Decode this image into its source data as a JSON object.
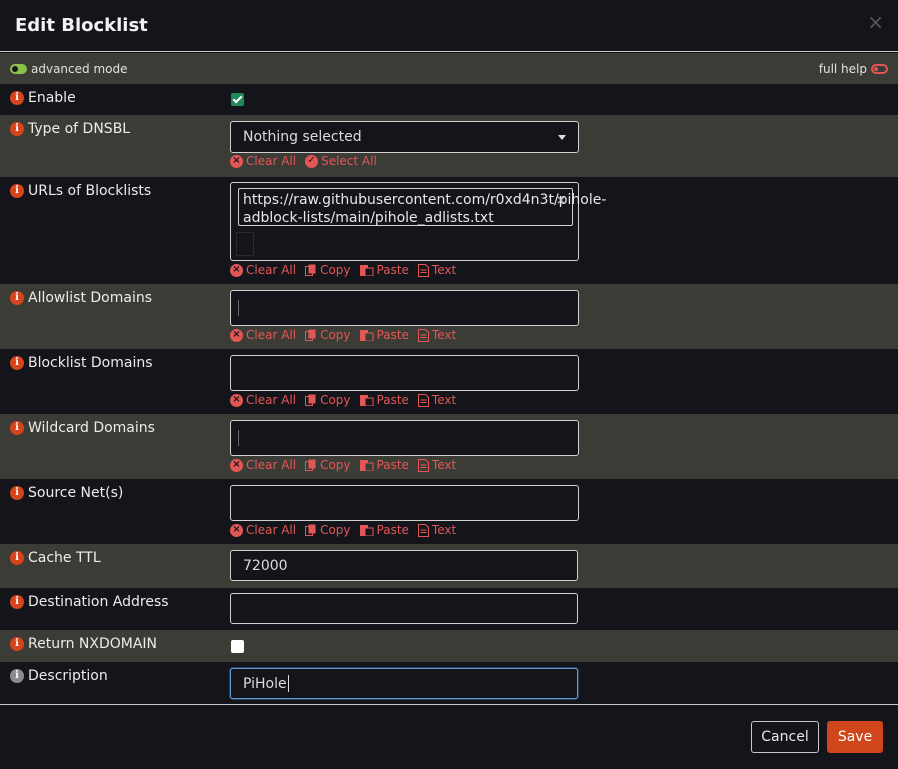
{
  "modal": {
    "title": "Edit Blocklist",
    "close": "×"
  },
  "bar": {
    "advanced": "advanced mode",
    "full_help": "full help"
  },
  "icons": {
    "info": "i"
  },
  "tools": {
    "clear_all": "Clear All",
    "select_all": "Select All",
    "copy": "Copy",
    "paste": "Paste",
    "text": "Text"
  },
  "fields": {
    "enable": {
      "label": "Enable",
      "checked": true
    },
    "type": {
      "label": "Type of DNSBL",
      "value": "Nothing selected"
    },
    "urls": {
      "label": "URLs of Blocklists",
      "tag": "https://raw.githubusercontent.com/r0xd4n3t/pihole-adblock-lists/main/pihole_adlists.txt",
      "tag_close": "×"
    },
    "allowlist": {
      "label": "Allowlist Domains"
    },
    "blocklist": {
      "label": "Blocklist Domains"
    },
    "wildcard": {
      "label": "Wildcard Domains"
    },
    "source": {
      "label": "Source Net(s)"
    },
    "cache": {
      "label": "Cache TTL",
      "value": "72000"
    },
    "dest": {
      "label": "Destination Address",
      "value": ""
    },
    "nxdomain": {
      "label": "Return NXDOMAIN",
      "checked": false
    },
    "description": {
      "label": "Description",
      "value": "PiHole"
    }
  },
  "footer": {
    "cancel": "Cancel",
    "save": "Save"
  },
  "colors": {
    "accent": "#d0461b",
    "tool": "#e35656",
    "check": "#1e8a57",
    "alt_row": "#3c3c37"
  }
}
